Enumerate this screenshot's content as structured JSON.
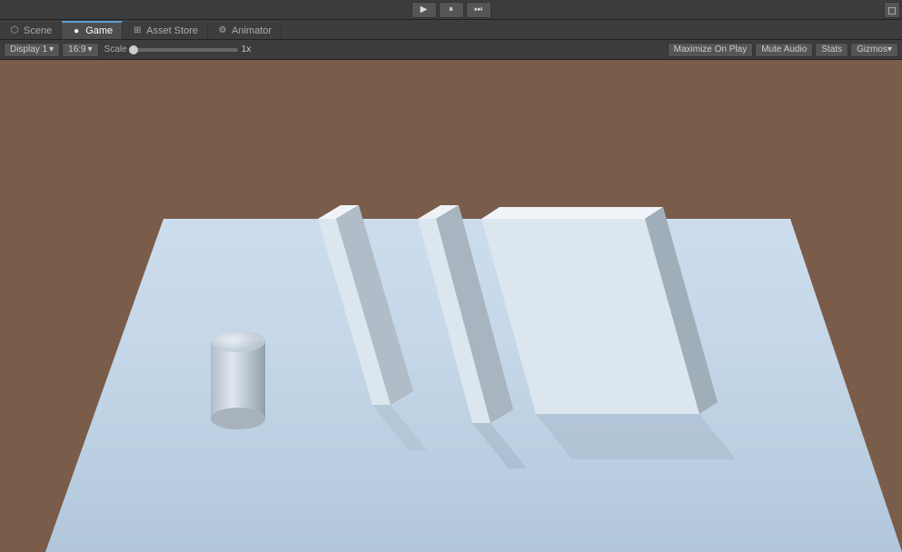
{
  "toolbar": {
    "play_label": "▶",
    "pause_label": "⏸",
    "step_label": "⏭",
    "top_right_btn": "◻"
  },
  "tabs": [
    {
      "id": "scene",
      "label": "Scene",
      "icon": "⬡",
      "active": false
    },
    {
      "id": "game",
      "label": "Game",
      "icon": "●",
      "active": true
    },
    {
      "id": "asset_store",
      "label": "Asset Store",
      "icon": "⊞",
      "active": false
    },
    {
      "id": "animator",
      "label": "Animator",
      "icon": "⚙",
      "active": false
    }
  ],
  "options": {
    "display_label": "Display 1",
    "aspect_label": "16:9",
    "scale_label": "Scale",
    "scale_value": "1x",
    "maximize_label": "Maximize On Play",
    "mute_label": "Mute Audio",
    "stats_label": "Stats",
    "gizmos_label": "Gizmos"
  },
  "scene": {
    "description": "Unity Game view with 3D scene: flat platform with geometric shapes"
  }
}
